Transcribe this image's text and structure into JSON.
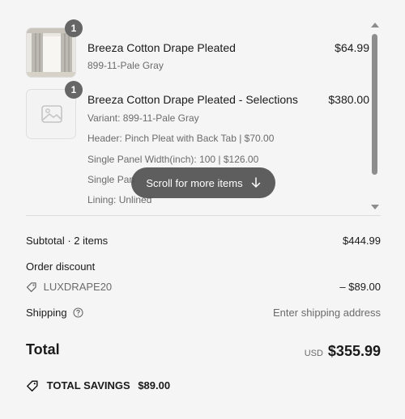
{
  "items": [
    {
      "quantity": "1",
      "title": "Breeza Cotton Drape Pleated",
      "subtitle": "899-11-Pale Gray",
      "price": "$64.99",
      "image": "curtain-thumbnail"
    },
    {
      "quantity": "1",
      "title": "Breeza Cotton Drape Pleated - Selections",
      "price": "$380.00",
      "image": "placeholder-image-icon",
      "details": [
        "Variant: 899-11-Pale Gray",
        "Header: Pinch Pleat with Back Tab | $70.00",
        "Single Panel Width(inch): 100 | $126.00",
        "Single Pan",
        "Lining: Unlined"
      ]
    }
  ],
  "scroll_hint": {
    "label": "Scroll for more items",
    "icon": "arrow-down-icon"
  },
  "summary": {
    "subtotal_label": "Subtotal · 2 items",
    "subtotal_value": "$444.99",
    "discount_label": "Order discount",
    "discount_code": "LUXDRAPE20",
    "discount_value": "– $89.00",
    "shipping_label": "Shipping",
    "shipping_value": "Enter shipping address",
    "total_label": "Total",
    "total_currency": "USD",
    "total_value": "$355.99",
    "savings_label": "TOTAL SAVINGS",
    "savings_value": "$89.00"
  },
  "colors": {
    "background": "#f5f5f5",
    "badge": "#666666",
    "pill": "#505050",
    "muted_text": "#6b6b6b"
  }
}
